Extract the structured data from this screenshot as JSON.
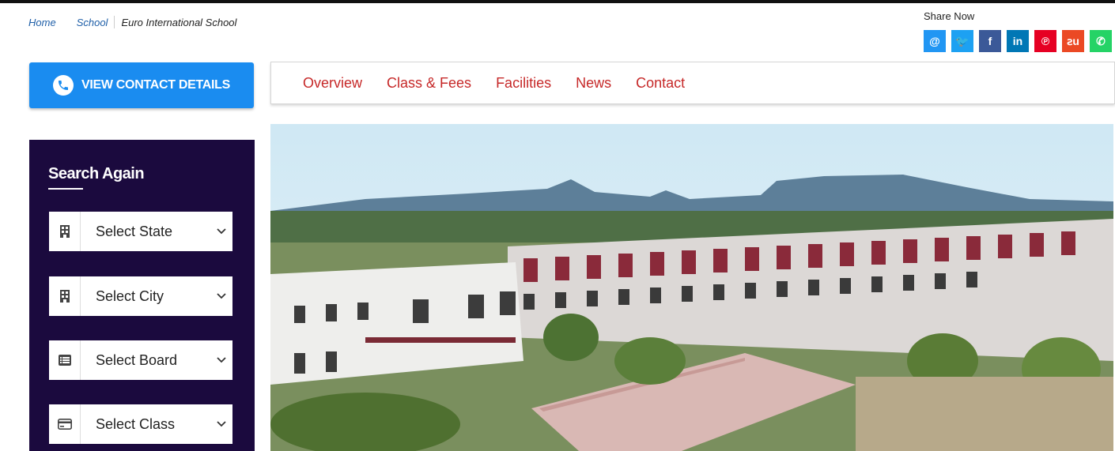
{
  "breadcrumb": {
    "home": "Home",
    "school": "School",
    "current": "Euro International School"
  },
  "share": {
    "label": "Share Now",
    "icons": [
      {
        "name": "email-icon",
        "glyph": "@",
        "color": "#2196f3"
      },
      {
        "name": "twitter-icon",
        "glyph": "🐦",
        "color": "#1da1f2"
      },
      {
        "name": "facebook-icon",
        "glyph": "f",
        "color": "#3b5998"
      },
      {
        "name": "linkedin-icon",
        "glyph": "in",
        "color": "#0077b5"
      },
      {
        "name": "pinterest-icon",
        "glyph": "℗",
        "color": "#e60023"
      },
      {
        "name": "stumbleupon-icon",
        "glyph": "ꙅu",
        "color": "#eb4924"
      },
      {
        "name": "whatsapp-icon",
        "glyph": "✆",
        "color": "#25d366"
      }
    ]
  },
  "contact_button": {
    "label": "VIEW CONTACT DETAILS"
  },
  "tabs": [
    "Overview",
    "Class & Fees",
    "Facilities",
    "News",
    "Contact"
  ],
  "search": {
    "title": "Search Again",
    "selects": [
      {
        "icon": "building-icon",
        "label": "Select State"
      },
      {
        "icon": "building-icon",
        "label": "Select City"
      },
      {
        "icon": "list-icon",
        "label": "Select Board"
      },
      {
        "icon": "card-icon",
        "label": "Select Class"
      }
    ]
  },
  "colors": {
    "accent_blue": "#1a8cf0",
    "tab_red": "#c62828",
    "panel_navy": "#1b0a3e"
  }
}
